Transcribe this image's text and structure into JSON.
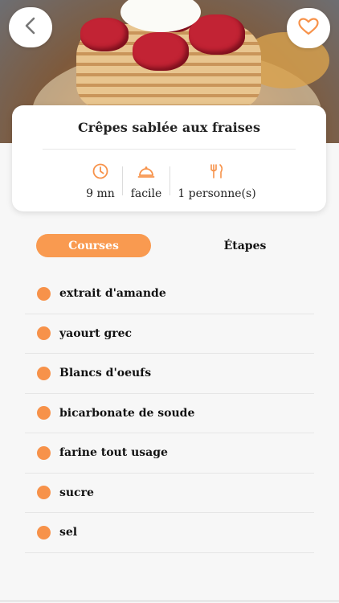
{
  "recipe": {
    "title": "Crêpes sablée aux fraises",
    "time": "9 mn",
    "difficulty": "facile",
    "servings": "1 personne(s)"
  },
  "tabs": {
    "courses": "Courses",
    "etapes": "Étapes",
    "active": "Courses"
  },
  "ingredients": [
    "extrait d'amande",
    "yaourt grec",
    "Blancs d'oeufs",
    "bicarbonate de soude",
    "farine tout usage",
    "sucre",
    "sel"
  ],
  "icons": {
    "back": "chevron-left-icon",
    "favorite": "heart-icon",
    "time": "clock-icon",
    "difficulty": "cloche-icon",
    "servings": "fork-knife-icon"
  },
  "colors": {
    "accent": "#f99a50",
    "bullet": "#f7924a",
    "background": "#f7f7f7"
  }
}
